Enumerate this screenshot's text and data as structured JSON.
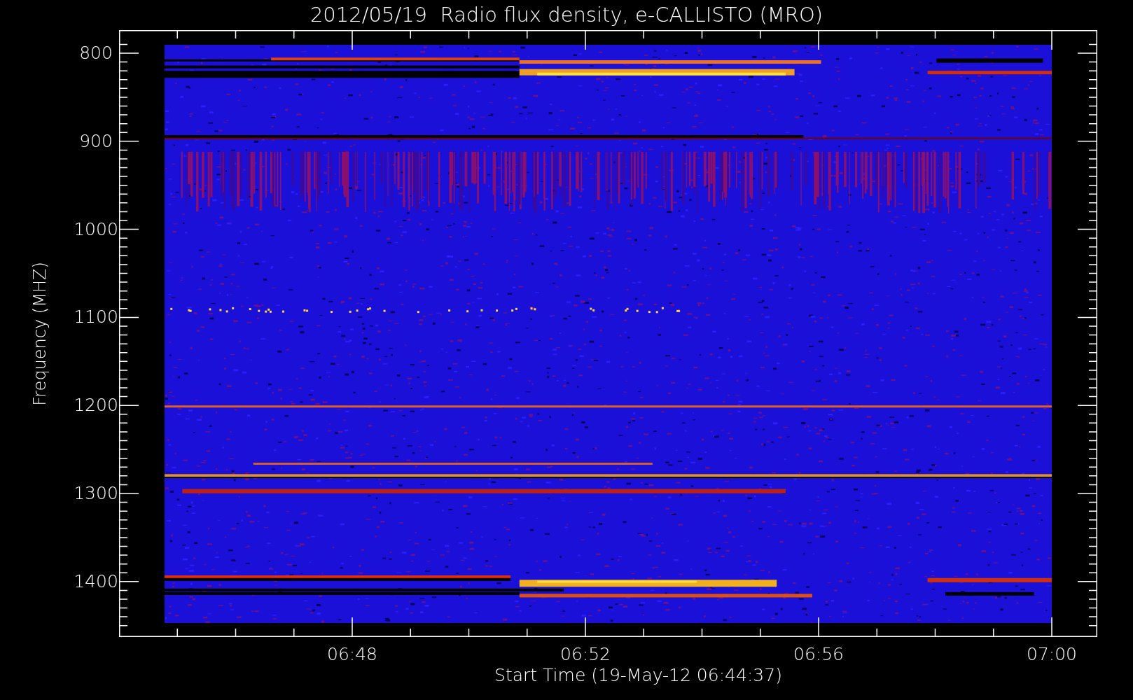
{
  "title": "2012/05/19  Radio flux density, e-CALLISTO (MRO)",
  "y_axis": {
    "label": "Frequency (MHZ)",
    "ticks": [
      "800",
      "900",
      "1000",
      "1100",
      "1200",
      "1300",
      "1400"
    ]
  },
  "x_axis": {
    "label": "Start Time (19-May-12 06:44:37)",
    "ticks": [
      "06:48",
      "06:52",
      "06:56",
      "07:00"
    ]
  }
}
